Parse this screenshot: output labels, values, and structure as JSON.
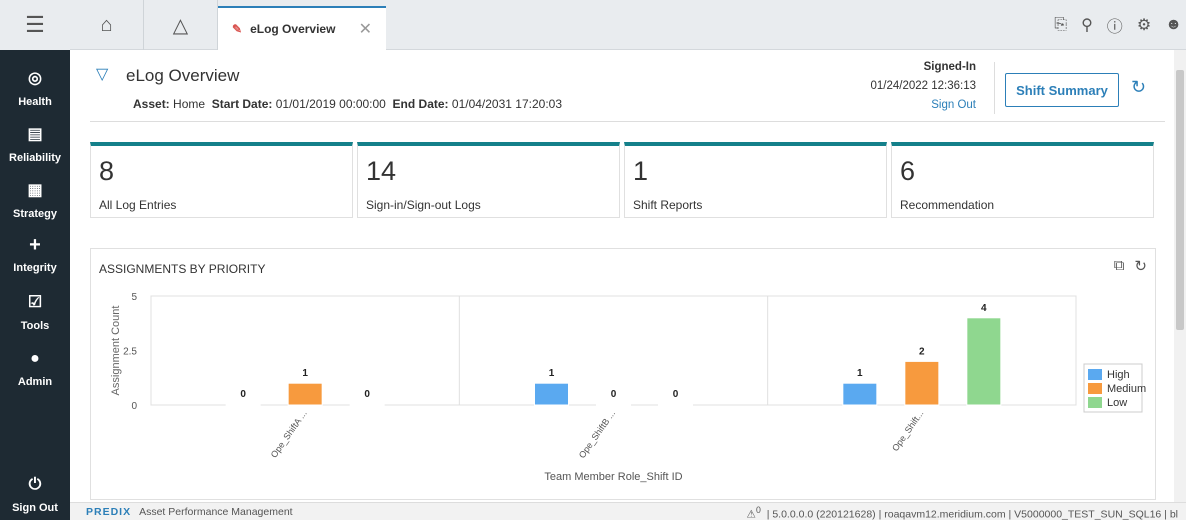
{
  "sidebar": {
    "menu_icon": "hamburger-icon",
    "items": [
      {
        "label": "Health",
        "icon": "target-icon"
      },
      {
        "label": "Reliability",
        "icon": "document-icon"
      },
      {
        "label": "Strategy",
        "icon": "list-icon"
      },
      {
        "label": "Integrity",
        "icon": "plus-icon"
      },
      {
        "label": "Tools",
        "icon": "checkbox-icon"
      },
      {
        "label": "Admin",
        "icon": "user-icon"
      }
    ],
    "signout_label": "Sign Out"
  },
  "tabs": {
    "active_label": "eLog Overview"
  },
  "header": {
    "title": "eLog Overview",
    "asset_label": "Asset:",
    "asset_value": "Home",
    "start_label": "Start Date:",
    "start_value": "01/01/2019 00:00:00",
    "end_label": "End Date:",
    "end_value": "01/04/2031 17:20:03",
    "signed_in_title": "Signed-In",
    "signed_in_time": "01/24/2022 12:36:13",
    "sign_out_link": "Sign Out",
    "shift_summary_label": "Shift Summary"
  },
  "cards": [
    {
      "value": "8",
      "label": "All Log Entries"
    },
    {
      "value": "14",
      "label": "Sign-in/Sign-out Logs"
    },
    {
      "value": "1",
      "label": "Shift Reports"
    },
    {
      "value": "6",
      "label": "Recommendation"
    }
  ],
  "panel": {
    "title": "ASSIGNMENTS BY PRIORITY"
  },
  "chart_data": {
    "type": "bar",
    "categories": [
      "Ope_ShiftA ...",
      "Ope_ShiftB ...",
      "Ope_Shift..."
    ],
    "series": [
      {
        "name": "High",
        "values": [
          0,
          1,
          1
        ],
        "color": "#5aa9f0"
      },
      {
        "name": "Medium",
        "values": [
          1,
          0,
          2
        ],
        "color": "#f79a3e"
      },
      {
        "name": "Low",
        "values": [
          0,
          0,
          4
        ],
        "color": "#8fd78f"
      }
    ],
    "xlabel": "Team Member Role_Shift ID",
    "ylabel": "Assignment Count",
    "ylim": [
      0,
      5
    ],
    "yticks": [
      "0",
      "2.5",
      "5"
    ],
    "legend": "right"
  },
  "footer": {
    "brand": "PREDIX",
    "product": "Asset Performance Management",
    "alert_count": "0",
    "info": "| 5.0.0.0.0 (220121628) | roaqavm12.meridium.com | V5000000_TEST_SUN_SQL16 | bl"
  }
}
